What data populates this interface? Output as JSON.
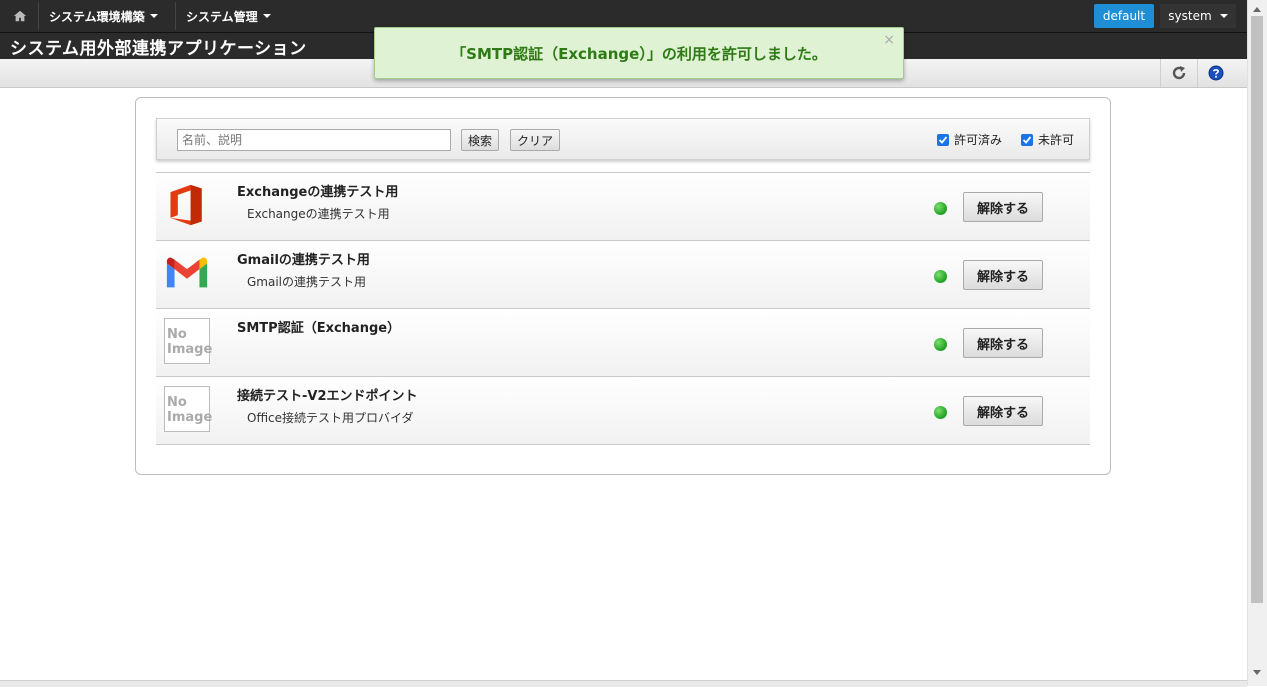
{
  "topbar": {
    "menus": [
      {
        "label": "システム環境構築"
      },
      {
        "label": "システム管理"
      }
    ],
    "tenant_label": "default",
    "user_label": "system"
  },
  "page_title": "システム用外部連携アプリケーション",
  "notification": {
    "message": "「SMTP認証（Exchange）」の利用を許可しました。",
    "close": "×"
  },
  "search": {
    "placeholder": "名前、説明",
    "search_label": "検索",
    "clear_label": "クリア",
    "filter_allowed": "許可済み",
    "filter_not_allowed": "未許可"
  },
  "apps": [
    {
      "name": "Exchangeの連携テスト用",
      "description": "Exchangeの連携テスト用",
      "icon": "office-icon",
      "action": "解除する"
    },
    {
      "name": "Gmailの連携テスト用",
      "description": "Gmailの連携テスト用",
      "icon": "gmail-icon",
      "action": "解除する"
    },
    {
      "name": "SMTP認証（Exchange）",
      "description": "",
      "icon": "no-image",
      "action": "解除する"
    },
    {
      "name": "接続テスト-V2エンドポイント",
      "description": "Office接続テスト用プロバイダ",
      "icon": "no-image",
      "action": "解除する"
    }
  ],
  "no_image_text": "No Image",
  "colors": {
    "nav_bg": "#2b2b2b",
    "tenant_btn": "#1e8fd6",
    "notice_bg": "#dff2d3",
    "notice_text": "#2e7a14",
    "status_ok": "#2aa82a"
  }
}
